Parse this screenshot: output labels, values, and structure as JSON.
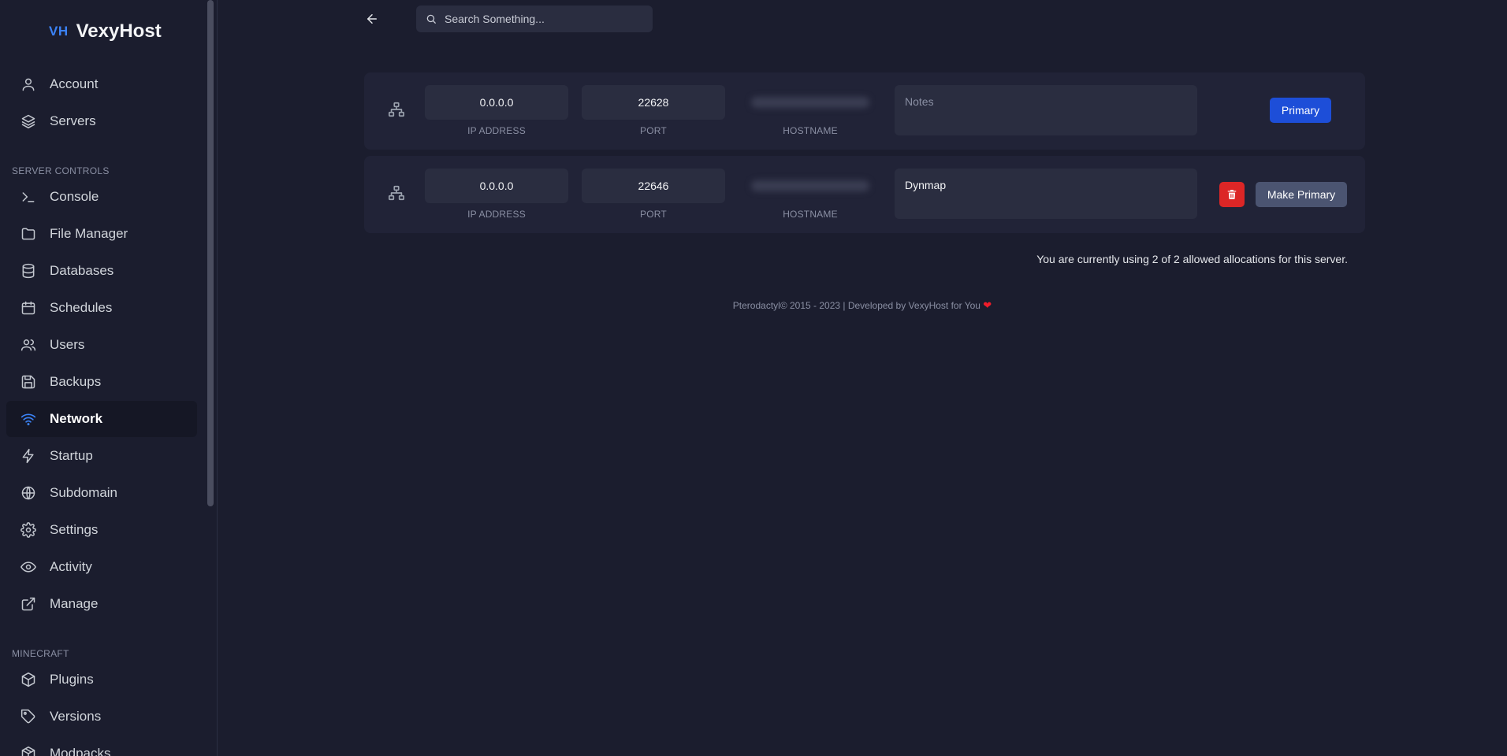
{
  "brand": {
    "mark": "VH",
    "name": "VexyHost"
  },
  "sidebar": {
    "items_top": [
      {
        "label": "Account",
        "icon": "user-icon"
      },
      {
        "label": "Servers",
        "icon": "layers-icon"
      }
    ],
    "section_server_controls": "SERVER CONTROLS",
    "items_controls": [
      {
        "label": "Console",
        "icon": "terminal-icon"
      },
      {
        "label": "File Manager",
        "icon": "folder-icon"
      },
      {
        "label": "Databases",
        "icon": "database-icon"
      },
      {
        "label": "Schedules",
        "icon": "calendar-icon"
      },
      {
        "label": "Users",
        "icon": "users-icon"
      },
      {
        "label": "Backups",
        "icon": "save-icon"
      },
      {
        "label": "Network",
        "icon": "wifi-icon",
        "active": true
      },
      {
        "label": "Startup",
        "icon": "zap-icon"
      },
      {
        "label": "Subdomain",
        "icon": "globe-icon"
      },
      {
        "label": "Settings",
        "icon": "gear-icon"
      },
      {
        "label": "Activity",
        "icon": "eye-icon"
      },
      {
        "label": "Manage",
        "icon": "external-link-icon"
      }
    ],
    "section_minecraft": "MINECRAFT",
    "items_minecraft": [
      {
        "label": "Plugins",
        "icon": "box-icon"
      },
      {
        "label": "Versions",
        "icon": "tag-icon"
      },
      {
        "label": "Modpacks",
        "icon": "package-icon"
      }
    ]
  },
  "search": {
    "placeholder": "Search Something..."
  },
  "allocations": [
    {
      "ip": "0.0.0.0",
      "ip_label": "IP ADDRESS",
      "port": "22628",
      "port_label": "PORT",
      "hostname_label": "HOSTNAME",
      "notes_value": "",
      "notes_placeholder": "Notes",
      "primary_label": "Primary"
    },
    {
      "ip": "0.0.0.0",
      "ip_label": "IP ADDRESS",
      "port": "22646",
      "port_label": "PORT",
      "hostname_label": "HOSTNAME",
      "notes_value": "Dynmap",
      "make_primary_label": "Make Primary"
    }
  ],
  "usage_text": "You are currently using 2 of 2 allowed allocations for this server.",
  "footer": {
    "text": "Pterodactyl© 2015 - 2023 | Developed by VexyHost for You",
    "heart": "❤"
  },
  "colors": {
    "accent": "#3b82f6",
    "primary_button": "#1d4ed8",
    "danger": "#dc2626",
    "background": "#1b1d2e"
  }
}
